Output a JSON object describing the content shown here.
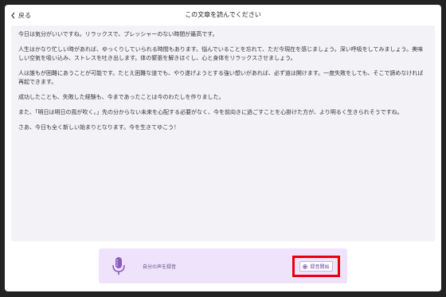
{
  "header": {
    "back_label": "戻る",
    "title": "この文章を読んでください"
  },
  "reading": {
    "paragraphs": [
      "今日は気分がいいですね。リラックスで、プレッシャーのない時間が最高です。",
      "人生はかなり忙しい時があれば、ゆっくりしていられる時間もあります。悩んでいることを忘れて、ただ今現在を感じましょう。深い呼吸をしてみましょう。美味しい空気を吸い込み、ストレスを吐き出します。体の緊張を解きほぐし、心と身体をリラックスさせましょう。",
      "人は誰もが困難にあうことが可能です。たとえ困難な道でも、やり遂げようとする強い想いがあれば、必ず道は開けます。一度失敗をしても、そこで諦めなければ再起できます。",
      "成功したことも、失敗した経験も、今まであったことは今のわたしを作りました。",
      "また、「明日は明日の風が吹く。」先の分からない未来を心配する必要がなく、今を前向きに過ごすことを心掛けた方が、より明るく生きられそうですね。",
      "さあ、今日も全く新しい始まりとなります。今を生きてゆこう！"
    ]
  },
  "recorder": {
    "label": "自分の声を録音",
    "start_label": "録音開始",
    "accent_color": "#6a3fa0",
    "panel_color": "#efe3fb",
    "highlight_color": "#e8000b",
    "mic_icon": "microphone-icon",
    "start_icon": "record-icon"
  }
}
